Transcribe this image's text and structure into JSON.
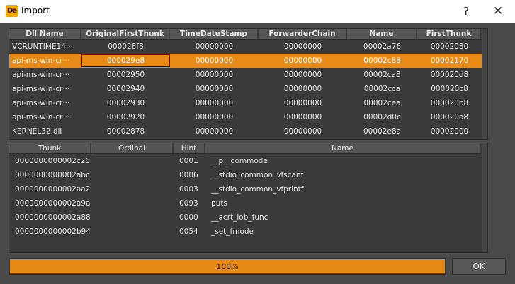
{
  "window": {
    "title": "Import",
    "icon_text": "De",
    "help_label": "?",
    "close_label": "✕"
  },
  "imports": {
    "columns": [
      "Dll Name",
      "OriginalFirstThunk",
      "TimeDateStamp",
      "ForwarderChain",
      "Name",
      "FirstThunk"
    ],
    "selected_index": 1,
    "rows": [
      [
        "VCRUNTIME14···",
        "000028f8",
        "00000000",
        "00000000",
        "00002a76",
        "00002080"
      ],
      [
        "api-ms-win-cr···",
        "000029e8",
        "00000000",
        "00000000",
        "00002c88",
        "00002170"
      ],
      [
        "api-ms-win-cr···",
        "00002950",
        "00000000",
        "00000000",
        "00002ca8",
        "000020d8"
      ],
      [
        "api-ms-win-cr···",
        "00002940",
        "00000000",
        "00000000",
        "00002cca",
        "000020c8"
      ],
      [
        "api-ms-win-cr···",
        "00002930",
        "00000000",
        "00000000",
        "00002cea",
        "000020b8"
      ],
      [
        "api-ms-win-cr···",
        "00002920",
        "00000000",
        "00000000",
        "00002d0c",
        "000020a8"
      ],
      [
        "KERNEL32.dll",
        "00002878",
        "00000000",
        "00000000",
        "00002e8a",
        "00002000"
      ]
    ]
  },
  "functions": {
    "columns": [
      "Thunk",
      "Ordinal",
      "Hint",
      "Name"
    ],
    "rows": [
      [
        "0000000000002c26",
        "",
        "0001",
        "__p__commode"
      ],
      [
        "0000000000002abc",
        "",
        "0006",
        "__stdio_common_vfscanf"
      ],
      [
        "0000000000002aa2",
        "",
        "0003",
        "__stdio_common_vfprintf"
      ],
      [
        "0000000000002a9a",
        "",
        "0093",
        "puts"
      ],
      [
        "0000000000002a88",
        "",
        "0000",
        "__acrt_iob_func"
      ],
      [
        "0000000000002b94",
        "",
        "0054",
        "_set_fmode"
      ]
    ]
  },
  "progress": {
    "label": "100%",
    "value": 1.0
  },
  "ok_label": "OK",
  "colors": {
    "accent": "#e98a16",
    "panel": "#3a3a3a",
    "header": "#555555"
  }
}
